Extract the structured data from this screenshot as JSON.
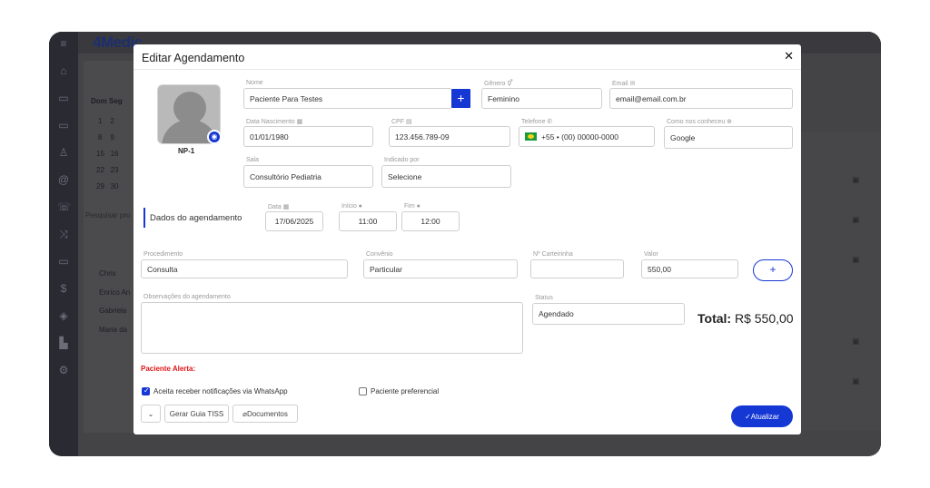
{
  "bg": {
    "logo": "4Medic",
    "calendar": {
      "days_header": [
        "Dom",
        "Seg"
      ],
      "rows": [
        [
          "1",
          "2"
        ],
        [
          "8",
          "9"
        ],
        [
          "15",
          "16"
        ],
        [
          "22",
          "23"
        ],
        [
          "29",
          "30"
        ]
      ]
    },
    "search_placeholder": "Pesquisar pro",
    "patients": [
      "Chris",
      "Enrico An",
      "Gabriela",
      "Maria da"
    ]
  },
  "modal": {
    "title": "Editar Agendamento",
    "photo_label": "NP-1",
    "nome": {
      "label": "Nome",
      "value": "Paciente Para Testes"
    },
    "genero": {
      "label": "Gênero",
      "value": "Feminino"
    },
    "email": {
      "label": "Email",
      "value": "email@email.com.br"
    },
    "nascimento": {
      "label": "Data Nascimento",
      "value": "01/01/1980"
    },
    "cpf": {
      "label": "CPF",
      "value": "123.456.789-09"
    },
    "telefone": {
      "label": "Telefone",
      "value": "+55 •  (00) 00000-0000"
    },
    "como_conheceu": {
      "label": "Como nos conheceu",
      "value": "Google"
    },
    "sala": {
      "label": "Sala",
      "value": "Consultório Pediatria"
    },
    "indicado": {
      "label": "Indicado por",
      "value": "Selecione"
    },
    "section_title": "Dados do agendamento",
    "data": {
      "label": "Data",
      "value": "17/06/2025"
    },
    "inicio": {
      "label": "Início",
      "value": "11:00"
    },
    "fim": {
      "label": "Fim",
      "value": "12:00"
    },
    "procedimento": {
      "label": "Procedimento",
      "value": "Consulta"
    },
    "convenio": {
      "label": "Convênio",
      "value": "Particular"
    },
    "carteirinha": {
      "label": "Nº Carteirinha",
      "value": ""
    },
    "valor": {
      "label": "Valor",
      "value": "550,00"
    },
    "observacoes": {
      "label": "Observações do agendamento",
      "value": ""
    },
    "status": {
      "label": "Status",
      "value": "Agendado"
    },
    "total_label": "Total:",
    "total_value": "R$ 550,00",
    "alert": "Paciente Alerta:",
    "whatsapp_label": "Aceita receber notificações via WhatsApp",
    "whatsapp_checked": true,
    "preferencial_label": "Paciente preferencial",
    "preferencial_checked": false,
    "guia_tiss": "Gerar Guia TISS",
    "documentos": "Documentos",
    "atualizar": "Atualizar"
  },
  "colors": {
    "accent": "#1537d4",
    "alert": "#e01515"
  }
}
